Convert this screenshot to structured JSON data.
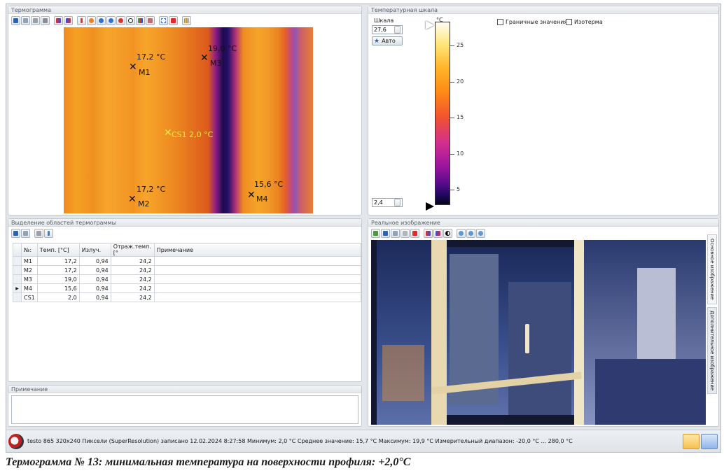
{
  "thermogram": {
    "title": "Термограмма",
    "markers": [
      {
        "id": "M1",
        "value": "17,2 °C"
      },
      {
        "id": "M3",
        "value": "19,0 °C"
      },
      {
        "id": "CS1",
        "value": "CS1 2,0 °C"
      },
      {
        "id": "M2",
        "value": "17,2 °C"
      },
      {
        "id": "M4",
        "value": "15,6 °C"
      }
    ]
  },
  "scale": {
    "title": "Температурная шкала",
    "label": "Шкала",
    "max": "27,6",
    "min": "2,4",
    "auto_label": "Авто",
    "unit": "°C",
    "ticks": [
      "25",
      "20",
      "15",
      "10",
      "5"
    ],
    "limits_label": "Граничные значения",
    "isotherm_label": "Изотерма"
  },
  "areas": {
    "title": "Выделение областей термограммы",
    "columns": [
      "№:",
      "Темп. [°C]",
      "Излуч.",
      "Отраж.темп. [°",
      "Примечание"
    ],
    "rows": [
      {
        "id": "M1",
        "temp": "17,2",
        "em": "0,94",
        "refl": "24,2",
        "note": ""
      },
      {
        "id": "M2",
        "temp": "17,2",
        "em": "0,94",
        "refl": "24,2",
        "note": ""
      },
      {
        "id": "M3",
        "temp": "19,0",
        "em": "0,94",
        "refl": "24,2",
        "note": ""
      },
      {
        "id": "M4",
        "temp": "15,6",
        "em": "0,94",
        "refl": "24,2",
        "note": ""
      },
      {
        "id": "CS1",
        "temp": "2,0",
        "em": "0,94",
        "refl": "24,2",
        "note": ""
      }
    ],
    "selected_row": 3
  },
  "note": {
    "title": "Примечание",
    "value": ""
  },
  "photo": {
    "title": "Реальное изображение",
    "side_tabs": [
      "Основное изображение",
      "Дополнительное изображение"
    ]
  },
  "status": {
    "text": "testo 865 320x240 Пиксели (SuperResolution) записано 12.02.2024 8:27:58 Минимум: 2,0 °C Среднее значение: 15,7 °C Максимум: 19,9 °C Измерительный диапазон: -20,0 °C ... 280,0 °C"
  },
  "caption": "Термограмма № 13: минимальная температура на поверхности профиля: +2,0°С",
  "colors": {
    "accent": "#f5a025",
    "cold": "#1a0b4e",
    "marker_cold": "#f2ec45"
  }
}
